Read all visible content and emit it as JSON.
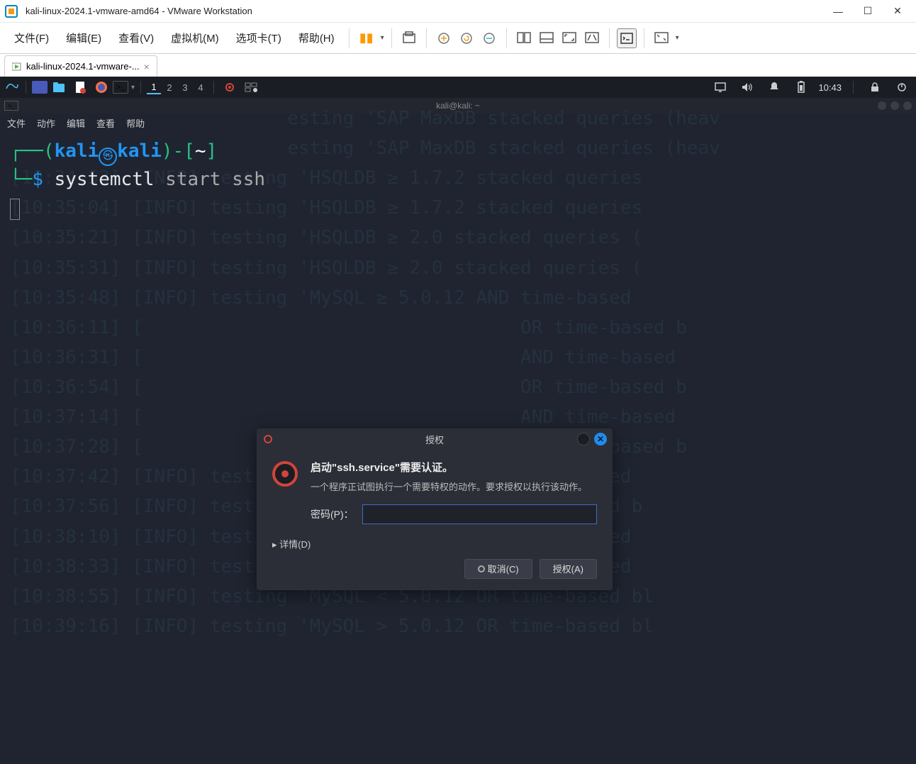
{
  "vmware": {
    "window_title": "kali-linux-2024.1-vmware-amd64 - VMware Workstation",
    "menu": {
      "file": "文件(F)",
      "edit": "编辑(E)",
      "view": "查看(V)",
      "vm": "虚拟机(M)",
      "tabs": "选项卡(T)",
      "help": "帮助(H)"
    },
    "tab": {
      "label": "kali-linux-2024.1-vmware-...",
      "close": "×"
    },
    "win_min": "—",
    "win_max": "☐",
    "win_close": "✕"
  },
  "kali_panel": {
    "workspaces": [
      "1",
      "2",
      "3",
      "4"
    ],
    "active_workspace": 0,
    "clock": "10:43"
  },
  "terminal": {
    "title": "kali@kali: ~",
    "menu": {
      "file": "文件",
      "actions": "动作",
      "edit": "编辑",
      "view": "查看",
      "help": "帮助"
    },
    "prompt": {
      "user": "kali",
      "host": "kali",
      "cwd": "~"
    },
    "command": "systemctl",
    "command_args": "start ssh",
    "bg_log": "                         esting 'SAP MaxDB stacked queries (heav\n                         esting 'SAP MaxDB stacked queries (heav\n[10:34:53] [INFO] testing 'HSQLDB ≥ 1.7.2 stacked queries\n[10:35:04] [INFO] testing 'HSQLDB ≥ 1.7.2 stacked queries\n[10:35:21] [INFO] testing 'HSQLDB ≥ 2.0 stacked queries (\n[10:35:31] [INFO] testing 'HSQLDB ≥ 2.0 stacked queries (\n[10:35:48] [INFO] testing 'MySQL ≥ 5.0.12 AND time-based \n[10:36:11] [                                  OR time-based b\n[10:36:31] [                                  AND time-based \n[10:36:54] [                                  OR time-based b\n[10:37:14] [                                  AND time-based \n[10:37:28] [                                  OR time-based b\n[10:37:42] [INFO] testing 'MySQL ≥ 5.0.12 AND time-based \n[10:37:56] [INFO] testing 'MySQL ≥ 5.0.12 OR time-based b\n[10:38:10] [INFO] testing 'MySQL < 5.0.12 AND time-based \n[10:38:33] [INFO] testing 'MySQL > 5.0.12 AND time-based \n[10:38:55] [INFO] testing 'MySQL < 5.0.12 OR time-based bl\n[10:39:16] [INFO] testing 'MySQL > 5.0.12 OR time-based bl"
  },
  "auth_dialog": {
    "title": "授权",
    "heading": "启动\"ssh.service\"需要认证。",
    "description": "一个程序正试图执行一个需要特权的动作。要求授权以执行该动作。",
    "password_label": "密码(P)：",
    "password_value": "",
    "details": "详情(D)",
    "cancel": "取消(C)",
    "authorize": "授权(A)",
    "close_x": "✕"
  }
}
